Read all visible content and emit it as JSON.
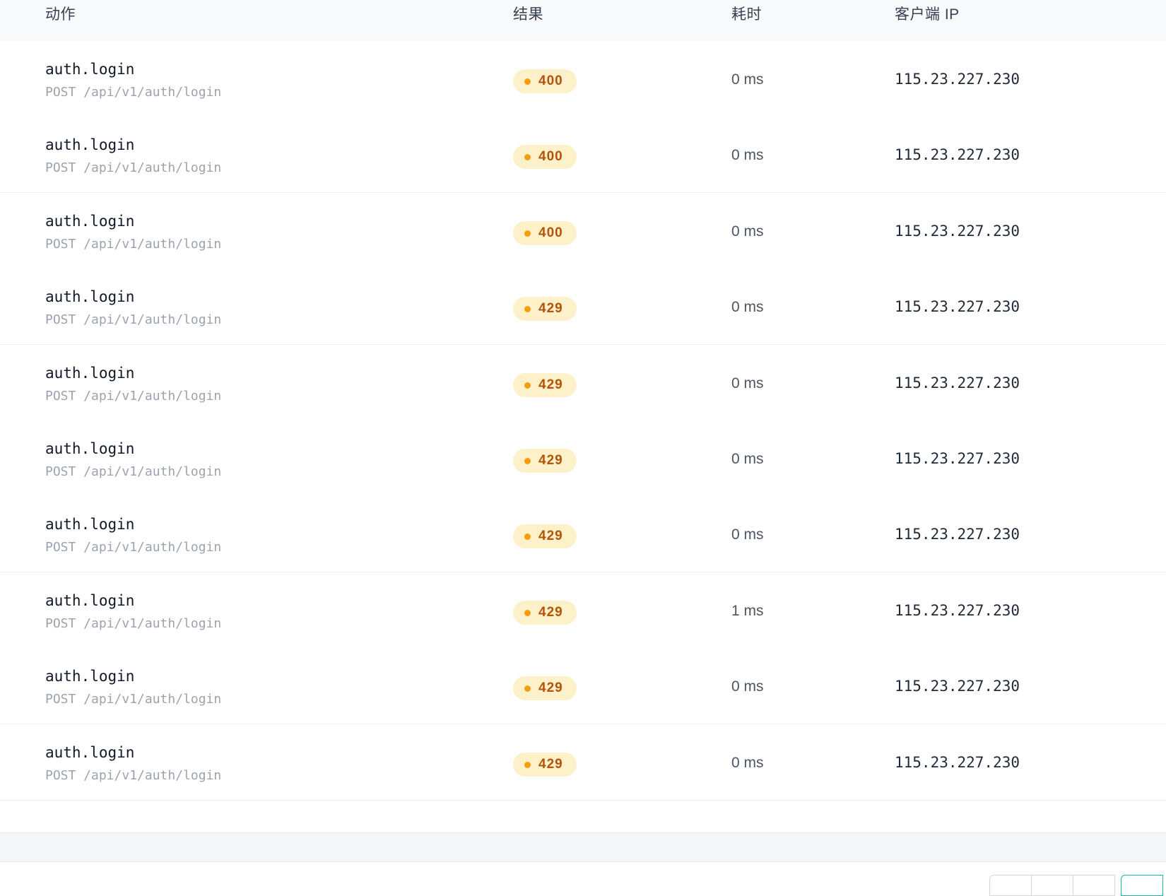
{
  "table": {
    "headers": {
      "action": "动作",
      "result": "结果",
      "duration": "耗时",
      "client_ip": "客户端 IP"
    },
    "rows": [
      {
        "action": "auth.login",
        "request": "POST /api/v1/auth/login",
        "status": "400",
        "duration": "0 ms",
        "ip": "115.23.227.230"
      },
      {
        "action": "auth.login",
        "request": "POST /api/v1/auth/login",
        "status": "400",
        "duration": "0 ms",
        "ip": "115.23.227.230"
      },
      {
        "action": "auth.login",
        "request": "POST /api/v1/auth/login",
        "status": "400",
        "duration": "0 ms",
        "ip": "115.23.227.230"
      },
      {
        "action": "auth.login",
        "request": "POST /api/v1/auth/login",
        "status": "429",
        "duration": "0 ms",
        "ip": "115.23.227.230"
      },
      {
        "action": "auth.login",
        "request": "POST /api/v1/auth/login",
        "status": "429",
        "duration": "0 ms",
        "ip": "115.23.227.230"
      },
      {
        "action": "auth.login",
        "request": "POST /api/v1/auth/login",
        "status": "429",
        "duration": "0 ms",
        "ip": "115.23.227.230"
      },
      {
        "action": "auth.login",
        "request": "POST /api/v1/auth/login",
        "status": "429",
        "duration": "0 ms",
        "ip": "115.23.227.230"
      },
      {
        "action": "auth.login",
        "request": "POST /api/v1/auth/login",
        "status": "429",
        "duration": "1 ms",
        "ip": "115.23.227.230"
      },
      {
        "action": "auth.login",
        "request": "POST /api/v1/auth/login",
        "status": "429",
        "duration": "0 ms",
        "ip": "115.23.227.230"
      },
      {
        "action": "auth.login",
        "request": "POST /api/v1/auth/login",
        "status": "429",
        "duration": "0 ms",
        "ip": "115.23.227.230"
      }
    ]
  },
  "colors": {
    "header_bg": "#f8fafc",
    "badge_bg": "#fdf1c9",
    "badge_dot": "#f59e0b",
    "badge_text": "#b45309",
    "pager_active": "#14b8a6"
  }
}
